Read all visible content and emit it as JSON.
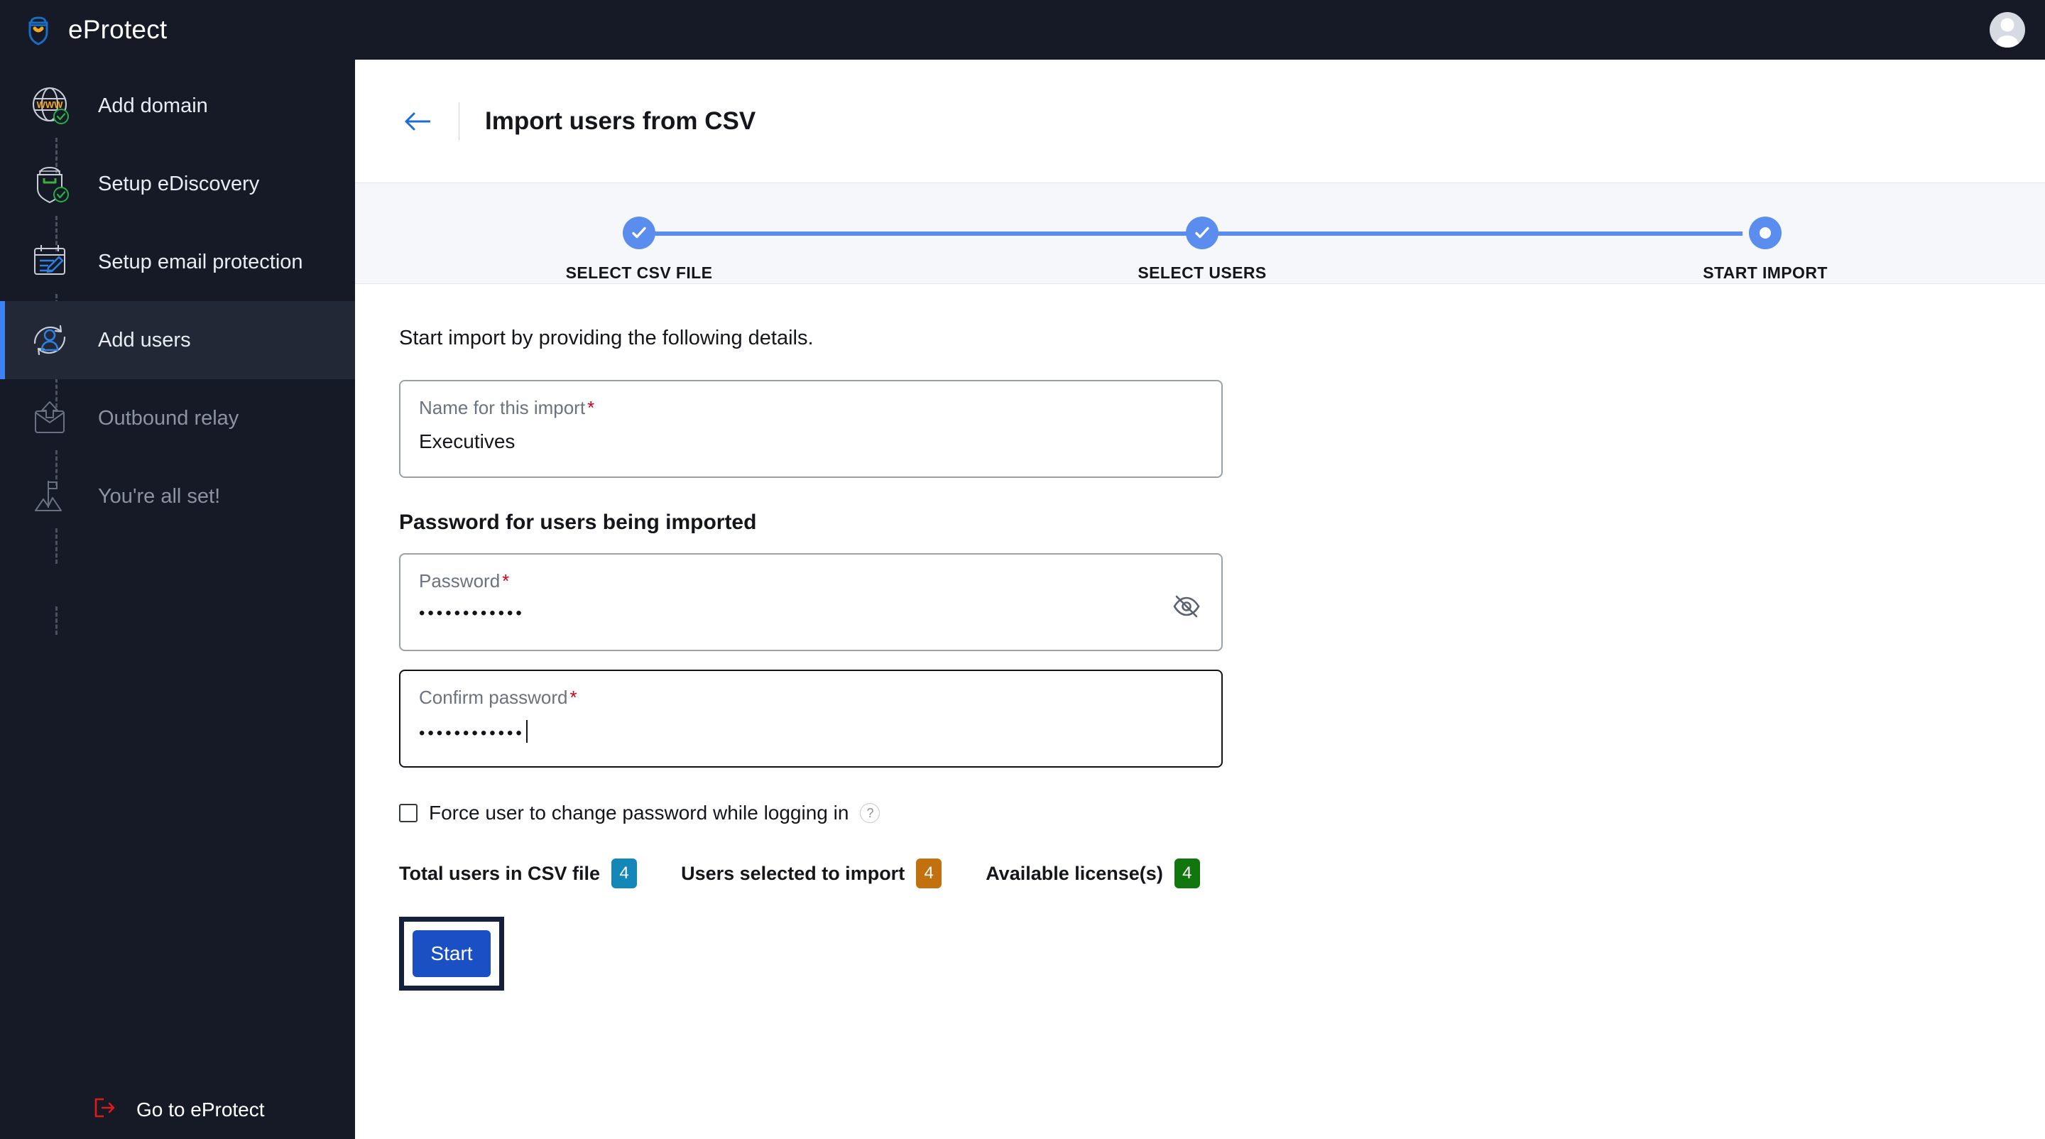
{
  "app": {
    "brand_name": "eProtect",
    "logo_icon": "shield-smile-logo",
    "avatar_icon": "user-avatar"
  },
  "sidebar": {
    "items": [
      {
        "label": "Add domain",
        "icon": "globe-www-check-icon",
        "state": "done",
        "name": "sidebar-item-add-domain"
      },
      {
        "label": "Setup eDiscovery",
        "icon": "shield-check-icon",
        "state": "done",
        "name": "sidebar-item-setup-ediscovery"
      },
      {
        "label": "Setup email protection",
        "icon": "form-pencil-icon",
        "state": "done",
        "name": "sidebar-item-setup-email-protection"
      },
      {
        "label": "Add users",
        "icon": "user-sync-icon",
        "state": "active",
        "name": "sidebar-item-add-users"
      },
      {
        "label": "Outbound relay",
        "icon": "envelope-up-icon",
        "state": "upcoming",
        "name": "sidebar-item-outbound-relay"
      },
      {
        "label": "You're all set!",
        "icon": "mountain-flag-icon",
        "state": "upcoming",
        "name": "sidebar-item-youre-all-set"
      }
    ],
    "footer": {
      "label": "Go to eProtect",
      "icon": "logout-icon",
      "color": "#e01a1a"
    }
  },
  "header": {
    "back_icon": "arrow-left-icon",
    "title": "Import users from CSV"
  },
  "stepper": {
    "steps": [
      {
        "label": "SELECT CSV FILE",
        "status": "complete"
      },
      {
        "label": "SELECT USERS",
        "status": "complete"
      },
      {
        "label": "START IMPORT",
        "status": "current"
      }
    ],
    "accent": "#5b8def"
  },
  "form": {
    "lead": "Start import by providing the following details.",
    "name_field": {
      "label": "Name for this import",
      "required_mark": "*",
      "value": "Executives"
    },
    "password_section_title": "Password for users being imported",
    "password_field": {
      "label": "Password",
      "required_mark": "*",
      "value": "••••••••••••",
      "toggle_icon": "eye-off-icon"
    },
    "confirm_field": {
      "label": "Confirm password",
      "required_mark": "*",
      "value": "••••••••••••",
      "focused": true
    },
    "force_change": {
      "label": "Force user to change password while logging in",
      "checked": false,
      "help_icon": "?"
    },
    "stats": [
      {
        "label": "Total users in CSV file",
        "value": "4",
        "color": "#1287b8"
      },
      {
        "label": "Users selected to import",
        "value": "4",
        "color": "#c2710e"
      },
      {
        "label": "Available license(s)",
        "value": "4",
        "color": "#12760f"
      }
    ],
    "start_button": "Start"
  }
}
